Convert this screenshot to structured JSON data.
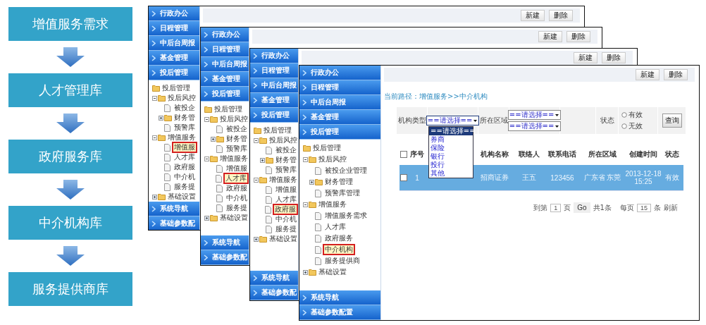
{
  "flow": [
    {
      "label": "增值服务需求"
    },
    {
      "label": "人才管理库"
    },
    {
      "label": "政府服务库"
    },
    {
      "label": "中介机构库"
    },
    {
      "label": "服务提供商库"
    }
  ],
  "windows": [
    {
      "kind": "back",
      "toolbar": [
        "新建",
        "删除"
      ],
      "nav_top": [
        "行政办公",
        "日程管理",
        "中后台周报",
        "基金管理",
        "投后管理"
      ],
      "tree": {
        "label": "投后管理",
        "kind": "folder",
        "selected": false,
        "children": [
          {
            "label": "投后风控",
            "kind": "folder",
            "expanded": true,
            "selected": false,
            "children": [
              {
                "label": "被投企",
                "kind": "page",
                "selected": false
              },
              {
                "label": "财务管",
                "kind": "folder",
                "expanded": false,
                "selected": false
              },
              {
                "label": "预警库",
                "kind": "page",
                "selected": false
              }
            ]
          },
          {
            "label": "增值服务",
            "kind": "folder",
            "expanded": true,
            "selected": false,
            "children": [
              {
                "label": "增值服",
                "kind": "page",
                "selected": true
              },
              {
                "label": "人才库",
                "kind": "page",
                "selected": false
              },
              {
                "label": "政府服",
                "kind": "page",
                "selected": false
              },
              {
                "label": "中介机",
                "kind": "page",
                "selected": false
              },
              {
                "label": "服务提",
                "kind": "page",
                "selected": false
              }
            ]
          },
          {
            "label": "基础设置",
            "kind": "folder",
            "expanded": false,
            "selected": false
          }
        ]
      },
      "nav_bottom": [
        "系统导航",
        "基础参数配"
      ]
    },
    {
      "kind": "back",
      "toolbar": [
        "新建",
        "删除"
      ],
      "nav_top": [
        "行政办公",
        "日程管理",
        "中后台周报",
        "基金管理",
        "投后管理"
      ],
      "tree": {
        "label": "投后管理",
        "kind": "folder",
        "selected": false,
        "children": [
          {
            "label": "投后风控",
            "kind": "folder",
            "expanded": true,
            "selected": false,
            "children": [
              {
                "label": "被投企",
                "kind": "page",
                "selected": false
              },
              {
                "label": "财务管",
                "kind": "folder",
                "expanded": false,
                "selected": false
              },
              {
                "label": "预警库",
                "kind": "page",
                "selected": false
              }
            ]
          },
          {
            "label": "增值服务",
            "kind": "folder",
            "expanded": true,
            "selected": false,
            "children": [
              {
                "label": "增值服",
                "kind": "page",
                "selected": false
              },
              {
                "label": "人才库",
                "kind": "page",
                "selected": true
              },
              {
                "label": "政府服",
                "kind": "page",
                "selected": false
              },
              {
                "label": "中介机",
                "kind": "page",
                "selected": false
              },
              {
                "label": "服务提",
                "kind": "page",
                "selected": false
              }
            ]
          },
          {
            "label": "基础设置",
            "kind": "folder",
            "expanded": false,
            "selected": false
          }
        ]
      },
      "nav_bottom": [
        "系统导航",
        "基础参数配"
      ]
    },
    {
      "kind": "back",
      "toolbar": [
        "新建",
        "删除"
      ],
      "nav_top": [
        "行政办公",
        "日程管理",
        "中后台周报",
        "基金管理",
        "投后管理"
      ],
      "tree": {
        "label": "投后管理",
        "kind": "folder",
        "selected": false,
        "children": [
          {
            "label": "投后风控",
            "kind": "folder",
            "expanded": true,
            "selected": false,
            "children": [
              {
                "label": "被投企",
                "kind": "page",
                "selected": false
              },
              {
                "label": "财务管",
                "kind": "folder",
                "expanded": false,
                "selected": false
              },
              {
                "label": "预警库",
                "kind": "page",
                "selected": false
              }
            ]
          },
          {
            "label": "增值服务",
            "kind": "folder",
            "expanded": true,
            "selected": false,
            "children": [
              {
                "label": "增值服",
                "kind": "page",
                "selected": false
              },
              {
                "label": "人才库",
                "kind": "page",
                "selected": false
              },
              {
                "label": "政府服",
                "kind": "page",
                "selected": true
              },
              {
                "label": "中介机",
                "kind": "page",
                "selected": false
              },
              {
                "label": "服务提",
                "kind": "page",
                "selected": false
              }
            ]
          },
          {
            "label": "基础设置",
            "kind": "folder",
            "expanded": false,
            "selected": false
          }
        ]
      },
      "nav_bottom": [
        "系统导航",
        "基础参数配"
      ]
    },
    {
      "kind": "front",
      "toolbar": [
        "新建",
        "删除"
      ],
      "nav_top": [
        "行政办公",
        "日程管理",
        "中后台周报",
        "基金管理",
        "投后管理"
      ],
      "tree": {
        "label": "投后管理",
        "kind": "folder",
        "selected": false,
        "children": [
          {
            "label": "投后风控",
            "kind": "folder",
            "expanded": true,
            "selected": false,
            "children": [
              {
                "label": "被投企业管理",
                "kind": "page",
                "selected": false
              },
              {
                "label": "财务管理",
                "kind": "folder",
                "expanded": false,
                "selected": false
              },
              {
                "label": "预警库管理",
                "kind": "page",
                "selected": false
              }
            ]
          },
          {
            "label": "增值服务",
            "kind": "folder",
            "expanded": true,
            "selected": false,
            "children": [
              {
                "label": "增值服务需求",
                "kind": "page",
                "selected": false
              },
              {
                "label": "人才库",
                "kind": "page",
                "selected": false
              },
              {
                "label": "政府服务",
                "kind": "page",
                "selected": false
              },
              {
                "label": "中介机构",
                "kind": "page",
                "selected": true
              },
              {
                "label": "服务提供商",
                "kind": "page",
                "selected": false
              }
            ]
          },
          {
            "label": "基础设置",
            "kind": "folder",
            "expanded": false,
            "selected": false
          }
        ]
      },
      "nav_bottom": [
        "系统导航",
        "基础参数配置"
      ],
      "breadcrumb": "当前路径：增值服务>>中介机构",
      "filter": {
        "type_label": "机构类型",
        "type_select": {
          "value": "==请选择==",
          "expanded": true,
          "options": [
            {
              "label": "==请选择==",
              "selected": true
            },
            {
              "label": "券商",
              "selected": false
            },
            {
              "label": "保险",
              "selected": false
            },
            {
              "label": "银行",
              "selected": false
            },
            {
              "label": "投行",
              "selected": false
            },
            {
              "label": "其他",
              "selected": false
            }
          ]
        },
        "region_label": "所在区域",
        "region_selects": [
          "==请选择==",
          "==请选择=="
        ],
        "status_label": "状态",
        "status_options": [
          {
            "label": "有效",
            "selected": false
          },
          {
            "label": "无效",
            "selected": false
          }
        ],
        "search_button": "查询"
      },
      "table": {
        "select_all_checked": false,
        "columns": [
          "序号",
          "机构名称",
          "联络人",
          "联系电话",
          "所在区域",
          "创建时间",
          "状态"
        ],
        "rows": [
          {
            "selected": true,
            "checked": false,
            "cells": [
              "1",
              "招商证券",
              "王五",
              "123456",
              "广东省 东莞",
              "2013-12-18 15:25",
              "有效"
            ]
          }
        ]
      },
      "pagination": {
        "goto_prefix": "到第",
        "page": "1",
        "page_suffix": "页",
        "go": "Go",
        "total": "共1条",
        "per_page_prefix": "每页",
        "per_page": "15",
        "per_page_suffix": "条",
        "refresh": "刷新"
      }
    }
  ]
}
